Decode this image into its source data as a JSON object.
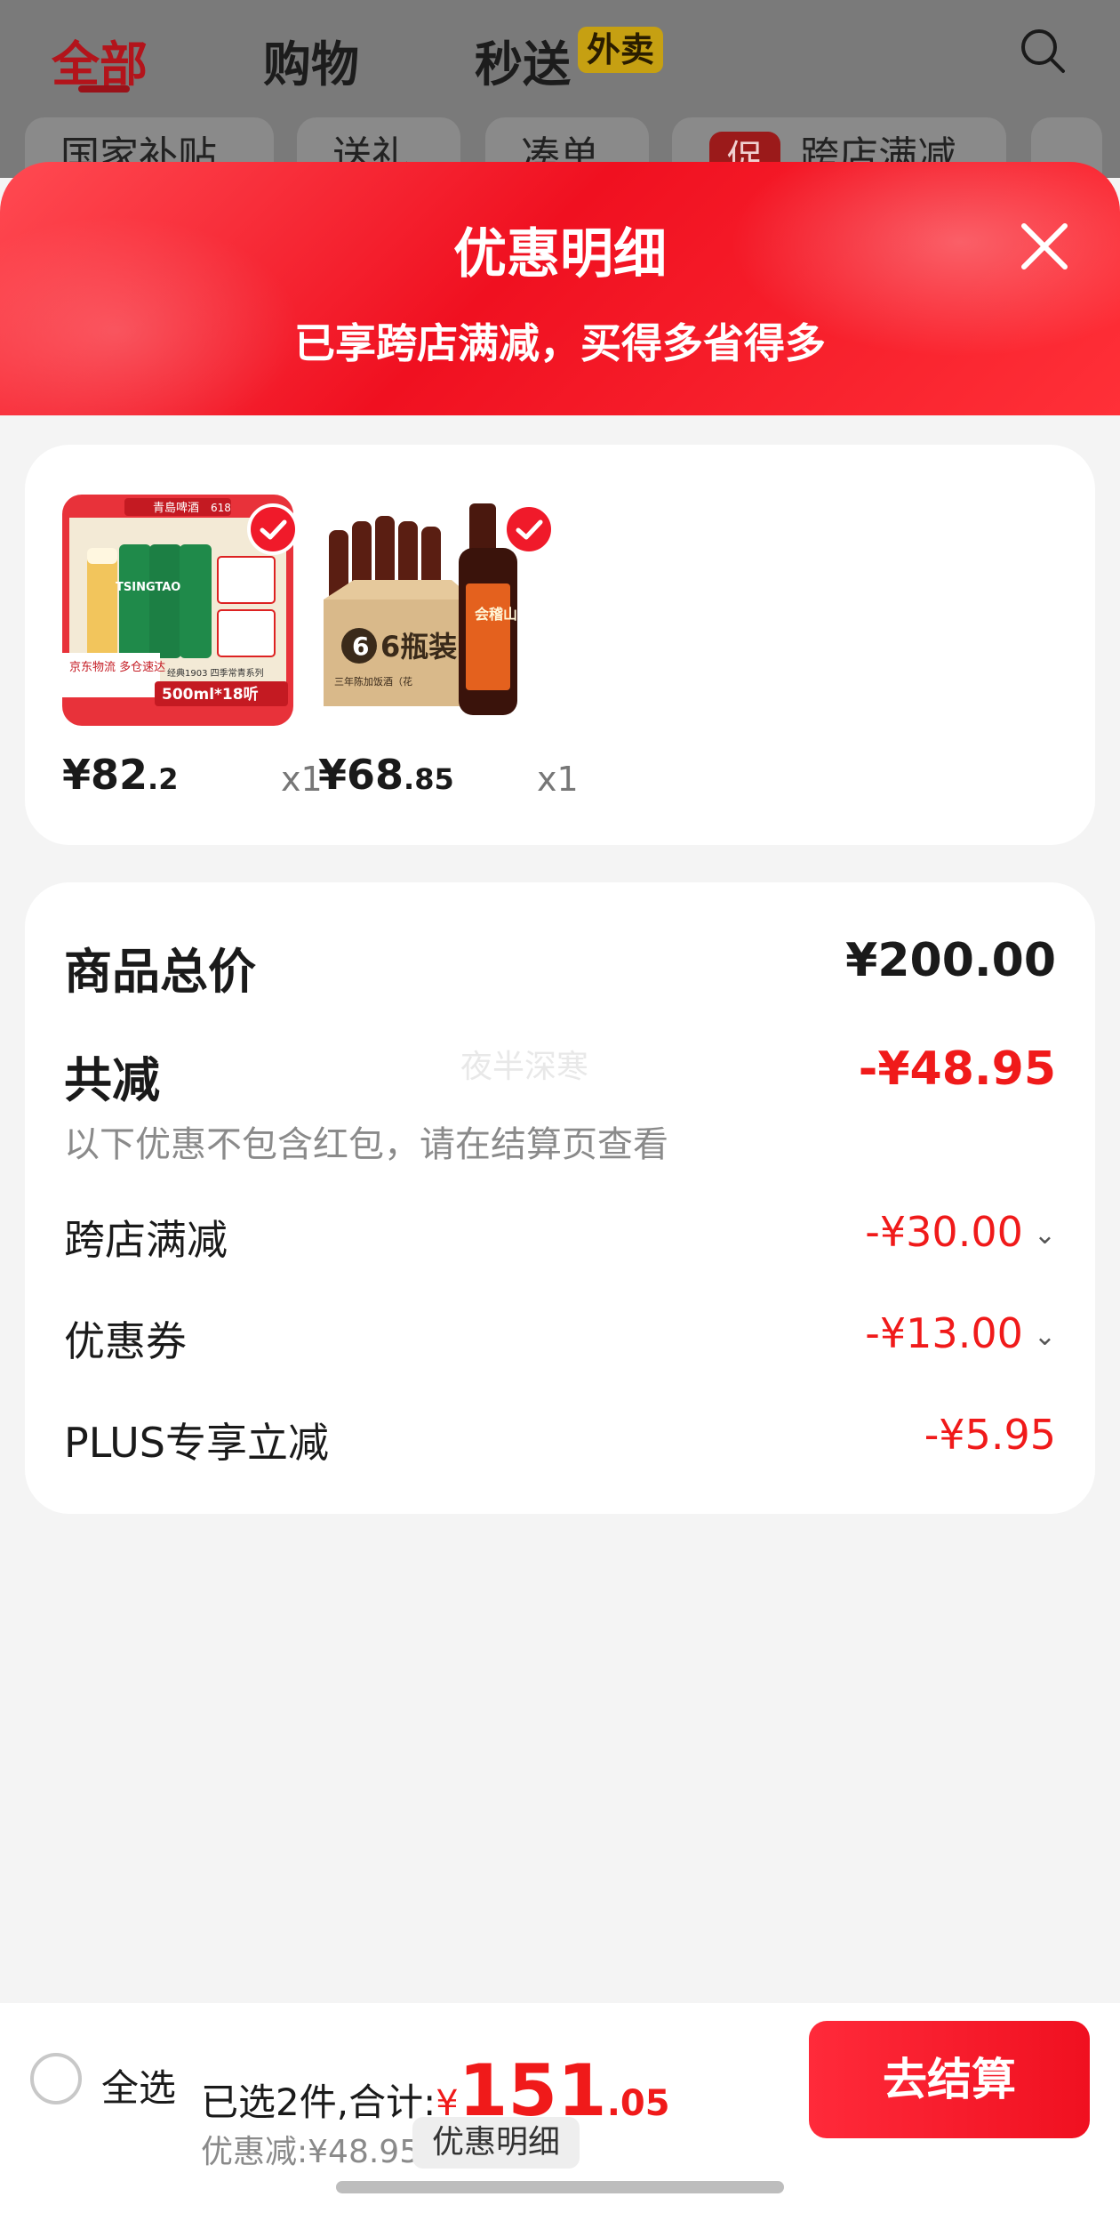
{
  "background_page": {
    "tabs": [
      "全部",
      "购物",
      "秒送"
    ],
    "active_tab": "全部",
    "takeaway_badge": "外卖",
    "chips": [
      "国家补贴",
      "送礼",
      "凑单",
      "跨店满减"
    ],
    "promo_badge": "促"
  },
  "sheet": {
    "title": "优惠明细",
    "subtitle": "已享跨店满减，买得多省得多"
  },
  "products": [
    {
      "name": "青岛啤酒 经典1903 500ml*18听",
      "price_yen": "¥",
      "price_int": "82",
      "price_dec": ".2",
      "qty": "x1",
      "selected": true
    },
    {
      "name": "会稽山 三年陈加饭酒 6瓶装",
      "price_yen": "¥",
      "price_int": "68",
      "price_dec": ".85",
      "qty": "x1",
      "selected": true
    }
  ],
  "product_images": {
    "beer_brand": "青島啤酒",
    "beer_618": "618",
    "beer_can_text": "TSINGTAO",
    "beer_logistics": "京东物流 多仓速达",
    "beer_spec": "500ml*18听",
    "beer_series": "经典1903 四季常青系列",
    "wine_box_text": "6瓶装",
    "wine_box_sub": "三年陈加饭酒（花",
    "wine_label": "会稽山"
  },
  "summary": {
    "total_label": "商品总价",
    "total_value": "¥200.00",
    "reduce_label": "共减",
    "reduce_value": "-¥48.95",
    "note": "以下优惠不包含红包，请在结算页查看",
    "watermark": "夜半深寒",
    "items": [
      {
        "label": "跨店满减",
        "value": "-¥30.00",
        "expandable": true
      },
      {
        "label": "优惠券",
        "value": "-¥13.00",
        "expandable": true
      },
      {
        "label": "PLUS专享立减",
        "value": "-¥5.95",
        "expandable": false
      }
    ]
  },
  "bottom_bar": {
    "select_all": "全选",
    "selected_prefix": "已选2件,合计:",
    "total_yen": "¥",
    "total_int": "151",
    "total_dec": ".05",
    "discount_text": "优惠减:¥48.95",
    "detail_button": "优惠明细",
    "checkout_button": "去结算"
  },
  "colors": {
    "accent_red": "#f01a1a",
    "header_gradient": "#f01020"
  }
}
